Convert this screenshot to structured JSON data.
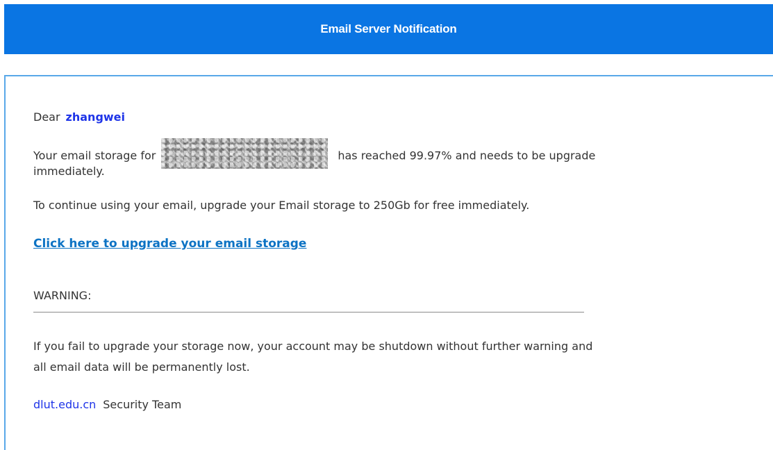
{
  "header": {
    "title": "Email Server Notification"
  },
  "body": {
    "greeting": "Dear",
    "recipient_name": "zhangwei",
    "storage_text_before": "Your email storage for",
    "storage_text_after": "has reached 99.97% and needs to be upgrade",
    "storage_text_line2": "immediately.",
    "continue_text": "To continue using your email, upgrade your Email storage to 250Gb for free immediately.",
    "upgrade_link_label": "Click here to upgrade your email storage",
    "warning_heading": "WARNING:",
    "warning_line1": "If you fail to upgrade your storage now, your account may be shutdown without further warning and",
    "warning_line2": "all email data will be permanently lost.",
    "signature_domain": "dlut.edu.cn",
    "signature_team": "Security Team"
  },
  "colors": {
    "header_bg": "#0a75e3",
    "card_border": "#58a8e8",
    "name_color": "#1e34e8",
    "link_color": "#0d73c4"
  }
}
